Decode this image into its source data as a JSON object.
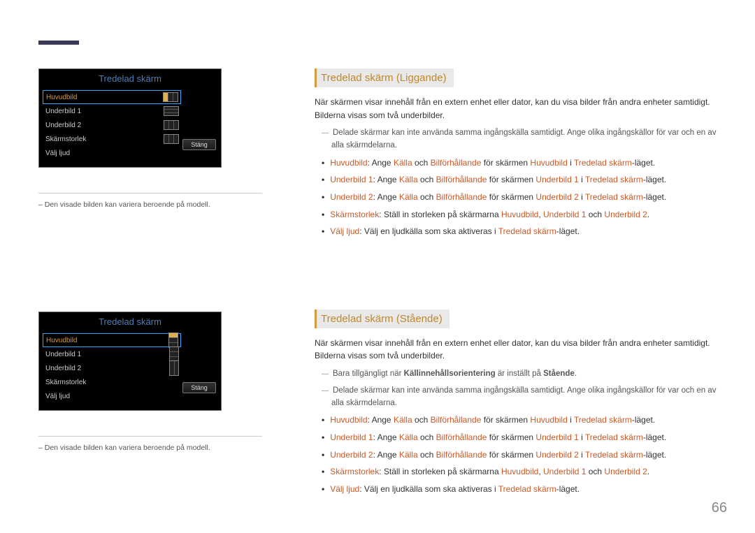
{
  "page_number": "66",
  "osd1": {
    "title": "Tredelad skärm",
    "items": [
      "Huvudbild",
      "Underbild 1",
      "Underbild 2",
      "Skärmstorlek",
      "Välj ljud"
    ],
    "close": "Stäng",
    "caption": "– Den visade bilden kan variera beroende på modell."
  },
  "osd2": {
    "title": "Tredelad skärm",
    "items": [
      "Huvudbild",
      "Underbild 1",
      "Underbild 2",
      "Skärmstorlek",
      "Välj ljud"
    ],
    "close": "Stäng",
    "caption": "– Den visade bilden kan variera beroende på modell."
  },
  "sec1": {
    "heading": "Tredelad skärm (Liggande)",
    "intro": "När skärmen visar innehåll från en extern enhet eller dator, kan du visa bilder från andra enheter samtidigt. Bilderna visas som två underbilder.",
    "note1a": "Delade skärmar kan inte använda samma ingångskälla samtidigt. Ange olika ingångskällor för var och en av alla skärmdelarna.",
    "b1": {
      "t1": "Huvudbild",
      "mid1": ": Ange ",
      "t2": "Källa",
      "mid2": " och ",
      "t3": "Bilförhållande",
      "mid3": " för skärmen ",
      "t4": "Huvudbild",
      "mid4": " i ",
      "t5": "Tredelad skärm",
      "tail": "-läget."
    },
    "b2": {
      "t1": "Underbild 1",
      "mid1": ": Ange ",
      "t2": "Källa",
      "mid2": " och ",
      "t3": "Bilförhållande",
      "mid3": " för skärmen ",
      "t4": "Underbild 1",
      "mid4": " i ",
      "t5": "Tredelad skärm",
      "tail": "-läget."
    },
    "b3": {
      "t1": "Underbild 2",
      "mid1": ": Ange ",
      "t2": "Källa",
      "mid2": " och ",
      "t3": "Bilförhållande",
      "mid3": " för skärmen ",
      "t4": "Underbild 2",
      "mid4": " i ",
      "t5": "Tredelad skärm",
      "tail": "-läget."
    },
    "b4": {
      "t1": "Skärmstorlek",
      "mid": ": Ställ in storleken på skärmarna ",
      "t2": "Huvudbild",
      "c1": ", ",
      "t3": "Underbild 1",
      "c2": " och ",
      "t4": "Underbild 2",
      "tail": "."
    },
    "b5": {
      "t1": "Välj ljud",
      "mid": ": Välj en ljudkälla som ska aktiveras i ",
      "t2": "Tredelad skärm",
      "tail": "-läget."
    }
  },
  "sec2": {
    "heading": "Tredelad skärm (Stående)",
    "intro": "När skärmen visar innehåll från en extern enhet eller dator, kan du visa bilder från andra enheter samtidigt. Bilderna visas som två underbilder.",
    "note0": {
      "pre": "Bara tillgängligt när ",
      "t": "Källinnehållsorientering",
      "mid": " är inställt på ",
      "t2": "Stående",
      "tail": "."
    },
    "note1a": "Delade skärmar kan inte använda samma ingångskälla samtidigt. Ange olika ingångskällor för var och en av alla skärmdelarna.",
    "b1": {
      "t1": "Huvudbild",
      "mid1": ": Ange ",
      "t2": "Källa",
      "mid2": " och ",
      "t3": "Bilförhållande",
      "mid3": " för skärmen ",
      "t4": "Huvudbild",
      "mid4": " i ",
      "t5": "Tredelad skärm",
      "tail": "-läget."
    },
    "b2": {
      "t1": "Underbild 1",
      "mid1": ": Ange ",
      "t2": "Källa",
      "mid2": " och ",
      "t3": "Bilförhållande",
      "mid3": " för skärmen ",
      "t4": "Underbild 1",
      "mid4": " i ",
      "t5": "Tredelad skärm",
      "tail": "-läget."
    },
    "b3": {
      "t1": "Underbild 2",
      "mid1": ": Ange ",
      "t2": "Källa",
      "mid2": " och ",
      "t3": "Bilförhållande",
      "mid3": " för skärmen ",
      "t4": "Underbild 2",
      "mid4": " i ",
      "t5": "Tredelad skärm",
      "tail": "-läget."
    },
    "b4": {
      "t1": "Skärmstorlek",
      "mid": ": Ställ in storleken på skärmarna ",
      "t2": "Huvudbild",
      "c1": ", ",
      "t3": "Underbild 1",
      "c2": " och ",
      "t4": "Underbild 2",
      "tail": "."
    },
    "b5": {
      "t1": "Välj ljud",
      "mid": ": Välj en ljudkälla som ska aktiveras i ",
      "t2": "Tredelad skärm",
      "tail": "-läget."
    }
  }
}
